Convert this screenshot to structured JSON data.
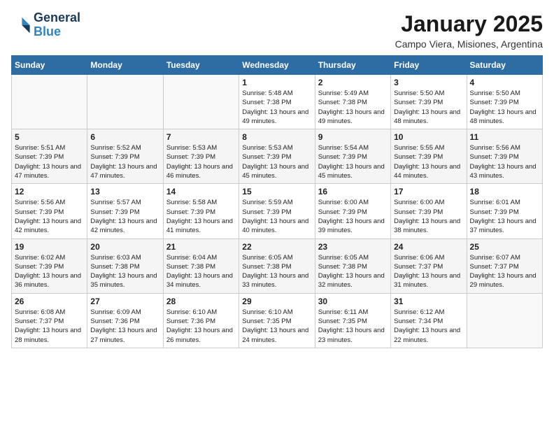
{
  "header": {
    "logo": {
      "line1": "General",
      "line2": "Blue"
    },
    "title": "January 2025",
    "location": "Campo Viera, Misiones, Argentina"
  },
  "weekdays": [
    "Sunday",
    "Monday",
    "Tuesday",
    "Wednesday",
    "Thursday",
    "Friday",
    "Saturday"
  ],
  "weeks": [
    [
      {
        "day": "",
        "sunrise": "",
        "sunset": "",
        "daylight": ""
      },
      {
        "day": "",
        "sunrise": "",
        "sunset": "",
        "daylight": ""
      },
      {
        "day": "",
        "sunrise": "",
        "sunset": "",
        "daylight": ""
      },
      {
        "day": "1",
        "sunrise": "Sunrise: 5:48 AM",
        "sunset": "Sunset: 7:38 PM",
        "daylight": "Daylight: 13 hours and 49 minutes."
      },
      {
        "day": "2",
        "sunrise": "Sunrise: 5:49 AM",
        "sunset": "Sunset: 7:38 PM",
        "daylight": "Daylight: 13 hours and 49 minutes."
      },
      {
        "day": "3",
        "sunrise": "Sunrise: 5:50 AM",
        "sunset": "Sunset: 7:39 PM",
        "daylight": "Daylight: 13 hours and 48 minutes."
      },
      {
        "day": "4",
        "sunrise": "Sunrise: 5:50 AM",
        "sunset": "Sunset: 7:39 PM",
        "daylight": "Daylight: 13 hours and 48 minutes."
      }
    ],
    [
      {
        "day": "5",
        "sunrise": "Sunrise: 5:51 AM",
        "sunset": "Sunset: 7:39 PM",
        "daylight": "Daylight: 13 hours and 47 minutes."
      },
      {
        "day": "6",
        "sunrise": "Sunrise: 5:52 AM",
        "sunset": "Sunset: 7:39 PM",
        "daylight": "Daylight: 13 hours and 47 minutes."
      },
      {
        "day": "7",
        "sunrise": "Sunrise: 5:53 AM",
        "sunset": "Sunset: 7:39 PM",
        "daylight": "Daylight: 13 hours and 46 minutes."
      },
      {
        "day": "8",
        "sunrise": "Sunrise: 5:53 AM",
        "sunset": "Sunset: 7:39 PM",
        "daylight": "Daylight: 13 hours and 45 minutes."
      },
      {
        "day": "9",
        "sunrise": "Sunrise: 5:54 AM",
        "sunset": "Sunset: 7:39 PM",
        "daylight": "Daylight: 13 hours and 45 minutes."
      },
      {
        "day": "10",
        "sunrise": "Sunrise: 5:55 AM",
        "sunset": "Sunset: 7:39 PM",
        "daylight": "Daylight: 13 hours and 44 minutes."
      },
      {
        "day": "11",
        "sunrise": "Sunrise: 5:56 AM",
        "sunset": "Sunset: 7:39 PM",
        "daylight": "Daylight: 13 hours and 43 minutes."
      }
    ],
    [
      {
        "day": "12",
        "sunrise": "Sunrise: 5:56 AM",
        "sunset": "Sunset: 7:39 PM",
        "daylight": "Daylight: 13 hours and 42 minutes."
      },
      {
        "day": "13",
        "sunrise": "Sunrise: 5:57 AM",
        "sunset": "Sunset: 7:39 PM",
        "daylight": "Daylight: 13 hours and 42 minutes."
      },
      {
        "day": "14",
        "sunrise": "Sunrise: 5:58 AM",
        "sunset": "Sunset: 7:39 PM",
        "daylight": "Daylight: 13 hours and 41 minutes."
      },
      {
        "day": "15",
        "sunrise": "Sunrise: 5:59 AM",
        "sunset": "Sunset: 7:39 PM",
        "daylight": "Daylight: 13 hours and 40 minutes."
      },
      {
        "day": "16",
        "sunrise": "Sunrise: 6:00 AM",
        "sunset": "Sunset: 7:39 PM",
        "daylight": "Daylight: 13 hours and 39 minutes."
      },
      {
        "day": "17",
        "sunrise": "Sunrise: 6:00 AM",
        "sunset": "Sunset: 7:39 PM",
        "daylight": "Daylight: 13 hours and 38 minutes."
      },
      {
        "day": "18",
        "sunrise": "Sunrise: 6:01 AM",
        "sunset": "Sunset: 7:39 PM",
        "daylight": "Daylight: 13 hours and 37 minutes."
      }
    ],
    [
      {
        "day": "19",
        "sunrise": "Sunrise: 6:02 AM",
        "sunset": "Sunset: 7:39 PM",
        "daylight": "Daylight: 13 hours and 36 minutes."
      },
      {
        "day": "20",
        "sunrise": "Sunrise: 6:03 AM",
        "sunset": "Sunset: 7:38 PM",
        "daylight": "Daylight: 13 hours and 35 minutes."
      },
      {
        "day": "21",
        "sunrise": "Sunrise: 6:04 AM",
        "sunset": "Sunset: 7:38 PM",
        "daylight": "Daylight: 13 hours and 34 minutes."
      },
      {
        "day": "22",
        "sunrise": "Sunrise: 6:05 AM",
        "sunset": "Sunset: 7:38 PM",
        "daylight": "Daylight: 13 hours and 33 minutes."
      },
      {
        "day": "23",
        "sunrise": "Sunrise: 6:05 AM",
        "sunset": "Sunset: 7:38 PM",
        "daylight": "Daylight: 13 hours and 32 minutes."
      },
      {
        "day": "24",
        "sunrise": "Sunrise: 6:06 AM",
        "sunset": "Sunset: 7:37 PM",
        "daylight": "Daylight: 13 hours and 31 minutes."
      },
      {
        "day": "25",
        "sunrise": "Sunrise: 6:07 AM",
        "sunset": "Sunset: 7:37 PM",
        "daylight": "Daylight: 13 hours and 29 minutes."
      }
    ],
    [
      {
        "day": "26",
        "sunrise": "Sunrise: 6:08 AM",
        "sunset": "Sunset: 7:37 PM",
        "daylight": "Daylight: 13 hours and 28 minutes."
      },
      {
        "day": "27",
        "sunrise": "Sunrise: 6:09 AM",
        "sunset": "Sunset: 7:36 PM",
        "daylight": "Daylight: 13 hours and 27 minutes."
      },
      {
        "day": "28",
        "sunrise": "Sunrise: 6:10 AM",
        "sunset": "Sunset: 7:36 PM",
        "daylight": "Daylight: 13 hours and 26 minutes."
      },
      {
        "day": "29",
        "sunrise": "Sunrise: 6:10 AM",
        "sunset": "Sunset: 7:35 PM",
        "daylight": "Daylight: 13 hours and 24 minutes."
      },
      {
        "day": "30",
        "sunrise": "Sunrise: 6:11 AM",
        "sunset": "Sunset: 7:35 PM",
        "daylight": "Daylight: 13 hours and 23 minutes."
      },
      {
        "day": "31",
        "sunrise": "Sunrise: 6:12 AM",
        "sunset": "Sunset: 7:34 PM",
        "daylight": "Daylight: 13 hours and 22 minutes."
      },
      {
        "day": "",
        "sunrise": "",
        "sunset": "",
        "daylight": ""
      }
    ]
  ]
}
